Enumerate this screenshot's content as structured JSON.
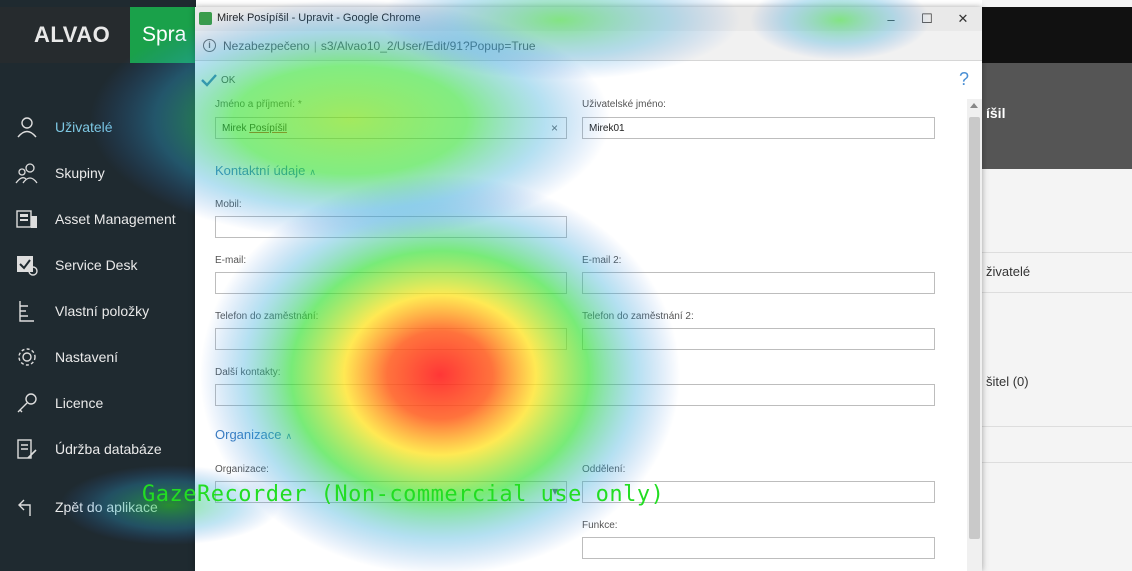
{
  "app": {
    "logo": "ALVAO",
    "brand_partial": "Spra"
  },
  "sidebar": {
    "items": [
      {
        "label": "Uživatelé",
        "icon": "user-icon",
        "active": true
      },
      {
        "label": "Skupiny",
        "icon": "group-icon"
      },
      {
        "label": "Asset Management",
        "icon": "asset-icon"
      },
      {
        "label": "Service Desk",
        "icon": "service-desk-icon"
      },
      {
        "label": "Vlastní položky",
        "icon": "custom-items-icon"
      },
      {
        "label": "Nastavení",
        "icon": "gear-icon"
      },
      {
        "label": "Licence",
        "icon": "key-icon"
      },
      {
        "label": "Údržba databáze",
        "icon": "database-maintenance-icon"
      },
      {
        "label": "Zpět do aplikace",
        "icon": "back-icon"
      }
    ]
  },
  "right_panel": {
    "title_partial": "íšil",
    "text1": "živatelé",
    "text2": "šitel (0)"
  },
  "window": {
    "title": "Mirek Posípíšil - Upravit - Google Chrome",
    "minimize": "–",
    "maximize": "☐",
    "close": "✕"
  },
  "address": {
    "security": "Nezabezpečeno",
    "url": "s3/Alvao10_2/User/Edit/91?Popup=True"
  },
  "toolbar": {
    "ok_label": "OK",
    "help": "?"
  },
  "form": {
    "name_label": "Jméno a příjmení: *",
    "name_first": "Mirek",
    "name_last": "Posípíšil",
    "clear": "×",
    "username_label": "Uživatelské jméno:",
    "username_value": "Mirek01",
    "contacts_section": "Kontaktní údaje",
    "mobile_label": "Mobil:",
    "email_label": "E-mail:",
    "email2_label": "E-mail 2:",
    "phone_label": "Telefon do zaměstnání:",
    "phone2_label": "Telefon do zaměstnání 2:",
    "other_label": "Další kontakty:",
    "org_section": "Organizace",
    "org_label": "Organizace:",
    "dept_label": "Oddělení:",
    "func_label": "Funkce:",
    "chevron": "∧"
  },
  "overlay": {
    "watermark": "GazeRecorder (Non-commercial use only)"
  },
  "colors": {
    "sidebar_bg": "#1f2a30",
    "brand_green": "#1aa14a",
    "link_blue": "#3a7bbf"
  }
}
